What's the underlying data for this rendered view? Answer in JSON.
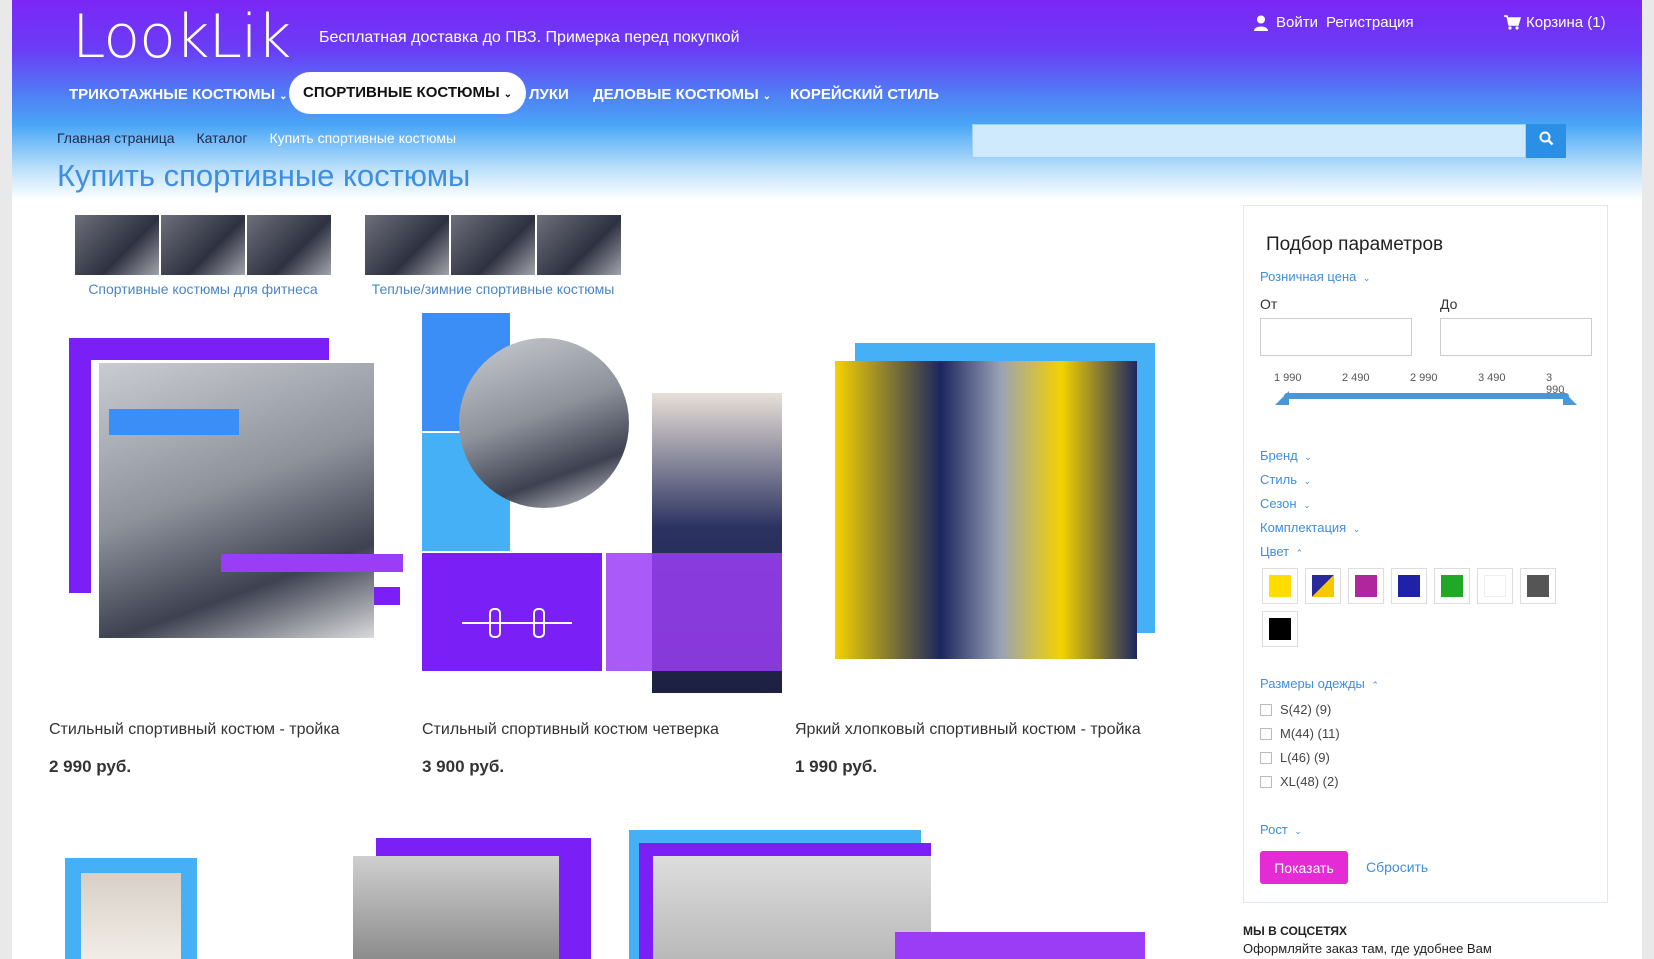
{
  "header": {
    "logo": "LookLik",
    "tagline": "Бесплатная доставка до ПВЗ. Примерка перед покупкой",
    "login": "Войти",
    "register": "Регистрация",
    "cart": "Корзина (1)"
  },
  "nav": [
    {
      "label": "ТРИКОТАЖНЫЕ КОСТЮМЫ",
      "has_dropdown": true
    },
    {
      "label": "СПОРТИВНЫЕ КОСТЮМЫ",
      "has_dropdown": true,
      "active": true
    },
    {
      "label": "ЛУКИ",
      "has_dropdown": false
    },
    {
      "label": "ДЕЛОВЫЕ КОСТЮМЫ",
      "has_dropdown": true
    },
    {
      "label": "КОРЕЙСКИЙ СТИЛЬ",
      "has_dropdown": false
    }
  ],
  "breadcrumbs": [
    "Главная страница",
    "Каталог",
    "Купить спортивные костюмы"
  ],
  "search": {
    "placeholder": ""
  },
  "page_title": "Купить спортивные костюмы",
  "subcategories": [
    {
      "label": "Спортивные костюмы для фитнеса"
    },
    {
      "label": "Теплые/зимние спортивные костюмы"
    }
  ],
  "products": [
    {
      "title": "Стильный спортивный костюм - тройка",
      "price": "2 990 руб."
    },
    {
      "title": "Стильный спортивный костюм четверка",
      "price": "3 900 руб."
    },
    {
      "title": "Яркий хлопковый спортивный костюм - тройка",
      "price": "1 990 руб."
    }
  ],
  "filter": {
    "title": "Подбор параметров",
    "price_label": "Розничная цена",
    "from_label": "От",
    "to_label": "До",
    "ticks": [
      "1 990",
      "2 490",
      "2 990",
      "3 490",
      "3 990"
    ],
    "brand": "Бренд",
    "style": "Стиль",
    "season": "Сезон",
    "set": "Комплектация",
    "color": "Цвет",
    "colors": [
      "#ffdd00",
      "split-navy-yellow",
      "#b0269c",
      "#1f22a8",
      "#21a828",
      "#ffffff",
      "#555555",
      "#000000"
    ],
    "sizes_label": "Размеры одежды",
    "sizes": [
      "S(42) (9)",
      "M(44) (11)",
      "L(46) (9)",
      "XL(48) (2)"
    ],
    "height": "Рост",
    "show": "Показать",
    "reset": "Сбросить"
  },
  "social": {
    "heading": "МЫ В СОЦСЕТЯХ",
    "text": "Оформляйте заказ там, где удобнее Вам"
  }
}
